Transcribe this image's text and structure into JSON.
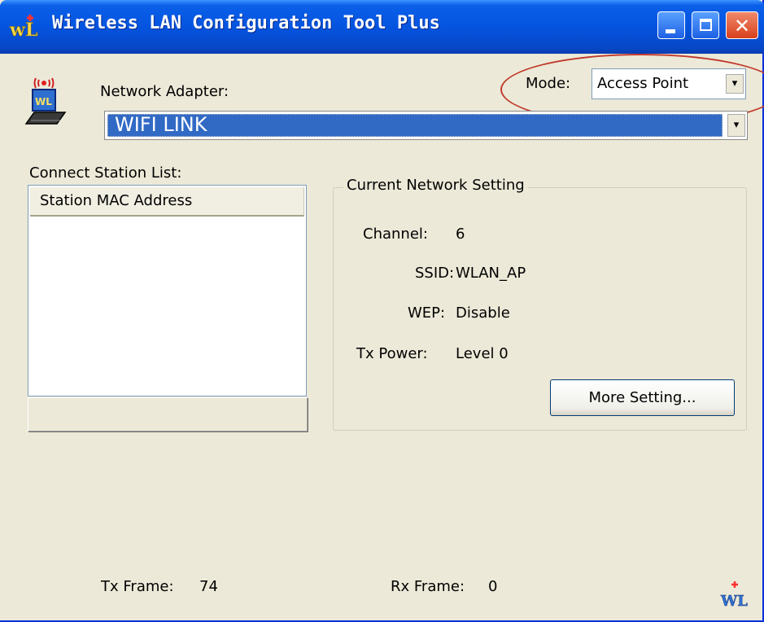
{
  "window": {
    "title": "Wireless LAN Configuration Tool Plus",
    "minimize": "minimize",
    "maximize": "maximize",
    "close": "✕"
  },
  "adapter": {
    "label": "Network Adapter:",
    "selected": "WIFI LINK"
  },
  "mode": {
    "label": "Mode:",
    "selected": "Access Point"
  },
  "stations": {
    "label": "Connect Station List:",
    "column": "Station MAC Address",
    "rows": []
  },
  "network": {
    "legend": "Current Network Setting",
    "channel_label": "Channel:",
    "channel": "6",
    "ssid_label": "SSID:",
    "ssid": "WLAN_AP",
    "wep_label": "WEP:",
    "wep": "Disable",
    "txpower_label": "Tx Power:",
    "txpower": "Level 0",
    "more_button": "More Setting..."
  },
  "stats": {
    "tx_label": "Tx Frame:",
    "tx_value": "74",
    "rx_label": "Rx Frame:",
    "rx_value": "0"
  },
  "colors": {
    "titlebar": "#0554e0",
    "face": "#ece9d8",
    "selection": "#316ac5",
    "annotation": "#c0392b"
  }
}
